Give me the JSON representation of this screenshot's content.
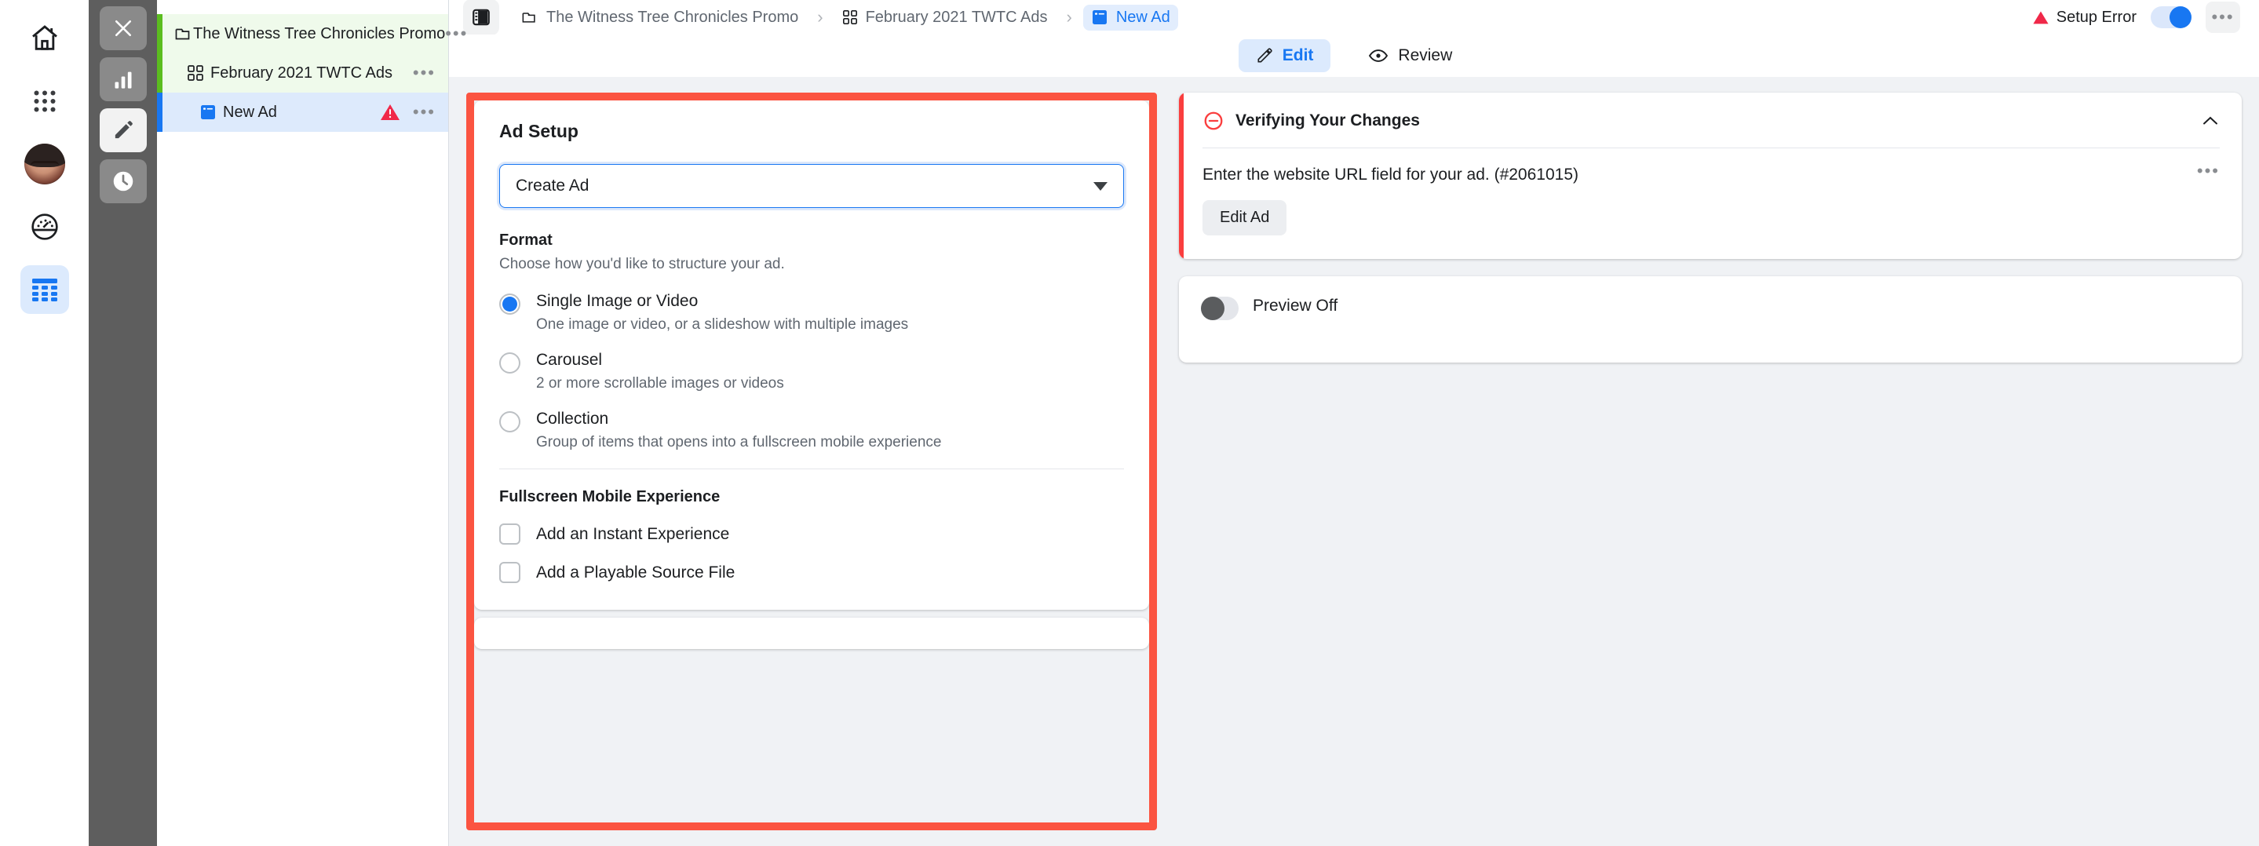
{
  "rail": {
    "items": [
      {
        "name": "home-icon",
        "label": "Home"
      },
      {
        "name": "apps-grid-icon",
        "label": "All Tools"
      },
      {
        "name": "avatar",
        "label": "Account"
      },
      {
        "name": "gauge-icon",
        "label": "Performance"
      },
      {
        "name": "table-icon",
        "label": "Ads Manager"
      }
    ]
  },
  "dark_rail": {
    "items": [
      {
        "name": "close-icon",
        "label": "Close"
      },
      {
        "name": "bar-chart-icon",
        "label": "Charts"
      },
      {
        "name": "pencil-icon",
        "label": "Edit"
      },
      {
        "name": "clock-icon",
        "label": "History"
      }
    ]
  },
  "tree": {
    "rows": [
      {
        "icon": "folder-icon",
        "label": "The Witness Tree Chronicles Promo",
        "level": "campaign",
        "menu": "•••",
        "warning": false
      },
      {
        "icon": "adset-grid-icon",
        "label": "February 2021 TWTC Ads",
        "level": "adset",
        "menu": "•••",
        "warning": false
      },
      {
        "icon": "ad-icon",
        "label": "New Ad",
        "level": "ad",
        "menu": "•••",
        "warning": true
      }
    ]
  },
  "topbar": {
    "panel_toggle": "sidebar-toggle-icon",
    "breadcrumbs": [
      {
        "icon": "folder-icon",
        "label": "The Witness Tree Chronicles Promo",
        "current": false
      },
      {
        "icon": "adset-grid-icon",
        "label": "February 2021 TWTC Ads",
        "current": false
      },
      {
        "icon": "ad-icon",
        "label": "New Ad",
        "current": true
      }
    ],
    "separator": "›",
    "status_label": "Setup Error",
    "toggle_state": "on",
    "kebab": "•••"
  },
  "tabs": [
    {
      "icon": "pencil-icon",
      "label": "Edit",
      "active": true
    },
    {
      "icon": "eye-icon",
      "label": "Review",
      "active": false
    }
  ],
  "ad_setup": {
    "title": "Ad Setup",
    "select": {
      "value": "Create Ad",
      "caret": "chevron-down-icon"
    },
    "format": {
      "heading": "Format",
      "subheading": "Choose how you'd like to structure your ad.",
      "options": [
        {
          "label": "Single Image or Video",
          "desc": "One image or video, or a slideshow with multiple images",
          "selected": true
        },
        {
          "label": "Carousel",
          "desc": "2 or more scrollable images or videos",
          "selected": false
        },
        {
          "label": "Collection",
          "desc": "Group of items that opens into a fullscreen mobile experience",
          "selected": false
        }
      ]
    },
    "fullscreen": {
      "heading": "Fullscreen Mobile Experience",
      "checkboxes": [
        {
          "label": "Add an Instant Experience",
          "checked": false
        },
        {
          "label": "Add a Playable Source File",
          "checked": false
        }
      ]
    },
    "highlight_color": "#fb5441"
  },
  "verify": {
    "icon": "error-circle-icon",
    "title": "Verifying Your Changes",
    "collapse": "chevron-up-icon",
    "message": "Enter the website URL field for your ad. (#2061015)",
    "message_menu": "•••",
    "action_label": "Edit Ad",
    "accent_color": "#fa3e3e"
  },
  "preview": {
    "label": "Preview Off",
    "toggle_state": "off"
  },
  "colors": {
    "brand_blue": "#1877f2",
    "error_red": "#fa3e3e",
    "highlight_red": "#fb5441",
    "green_accent": "#5bbd1f",
    "page_bg": "#f0f2f5"
  }
}
